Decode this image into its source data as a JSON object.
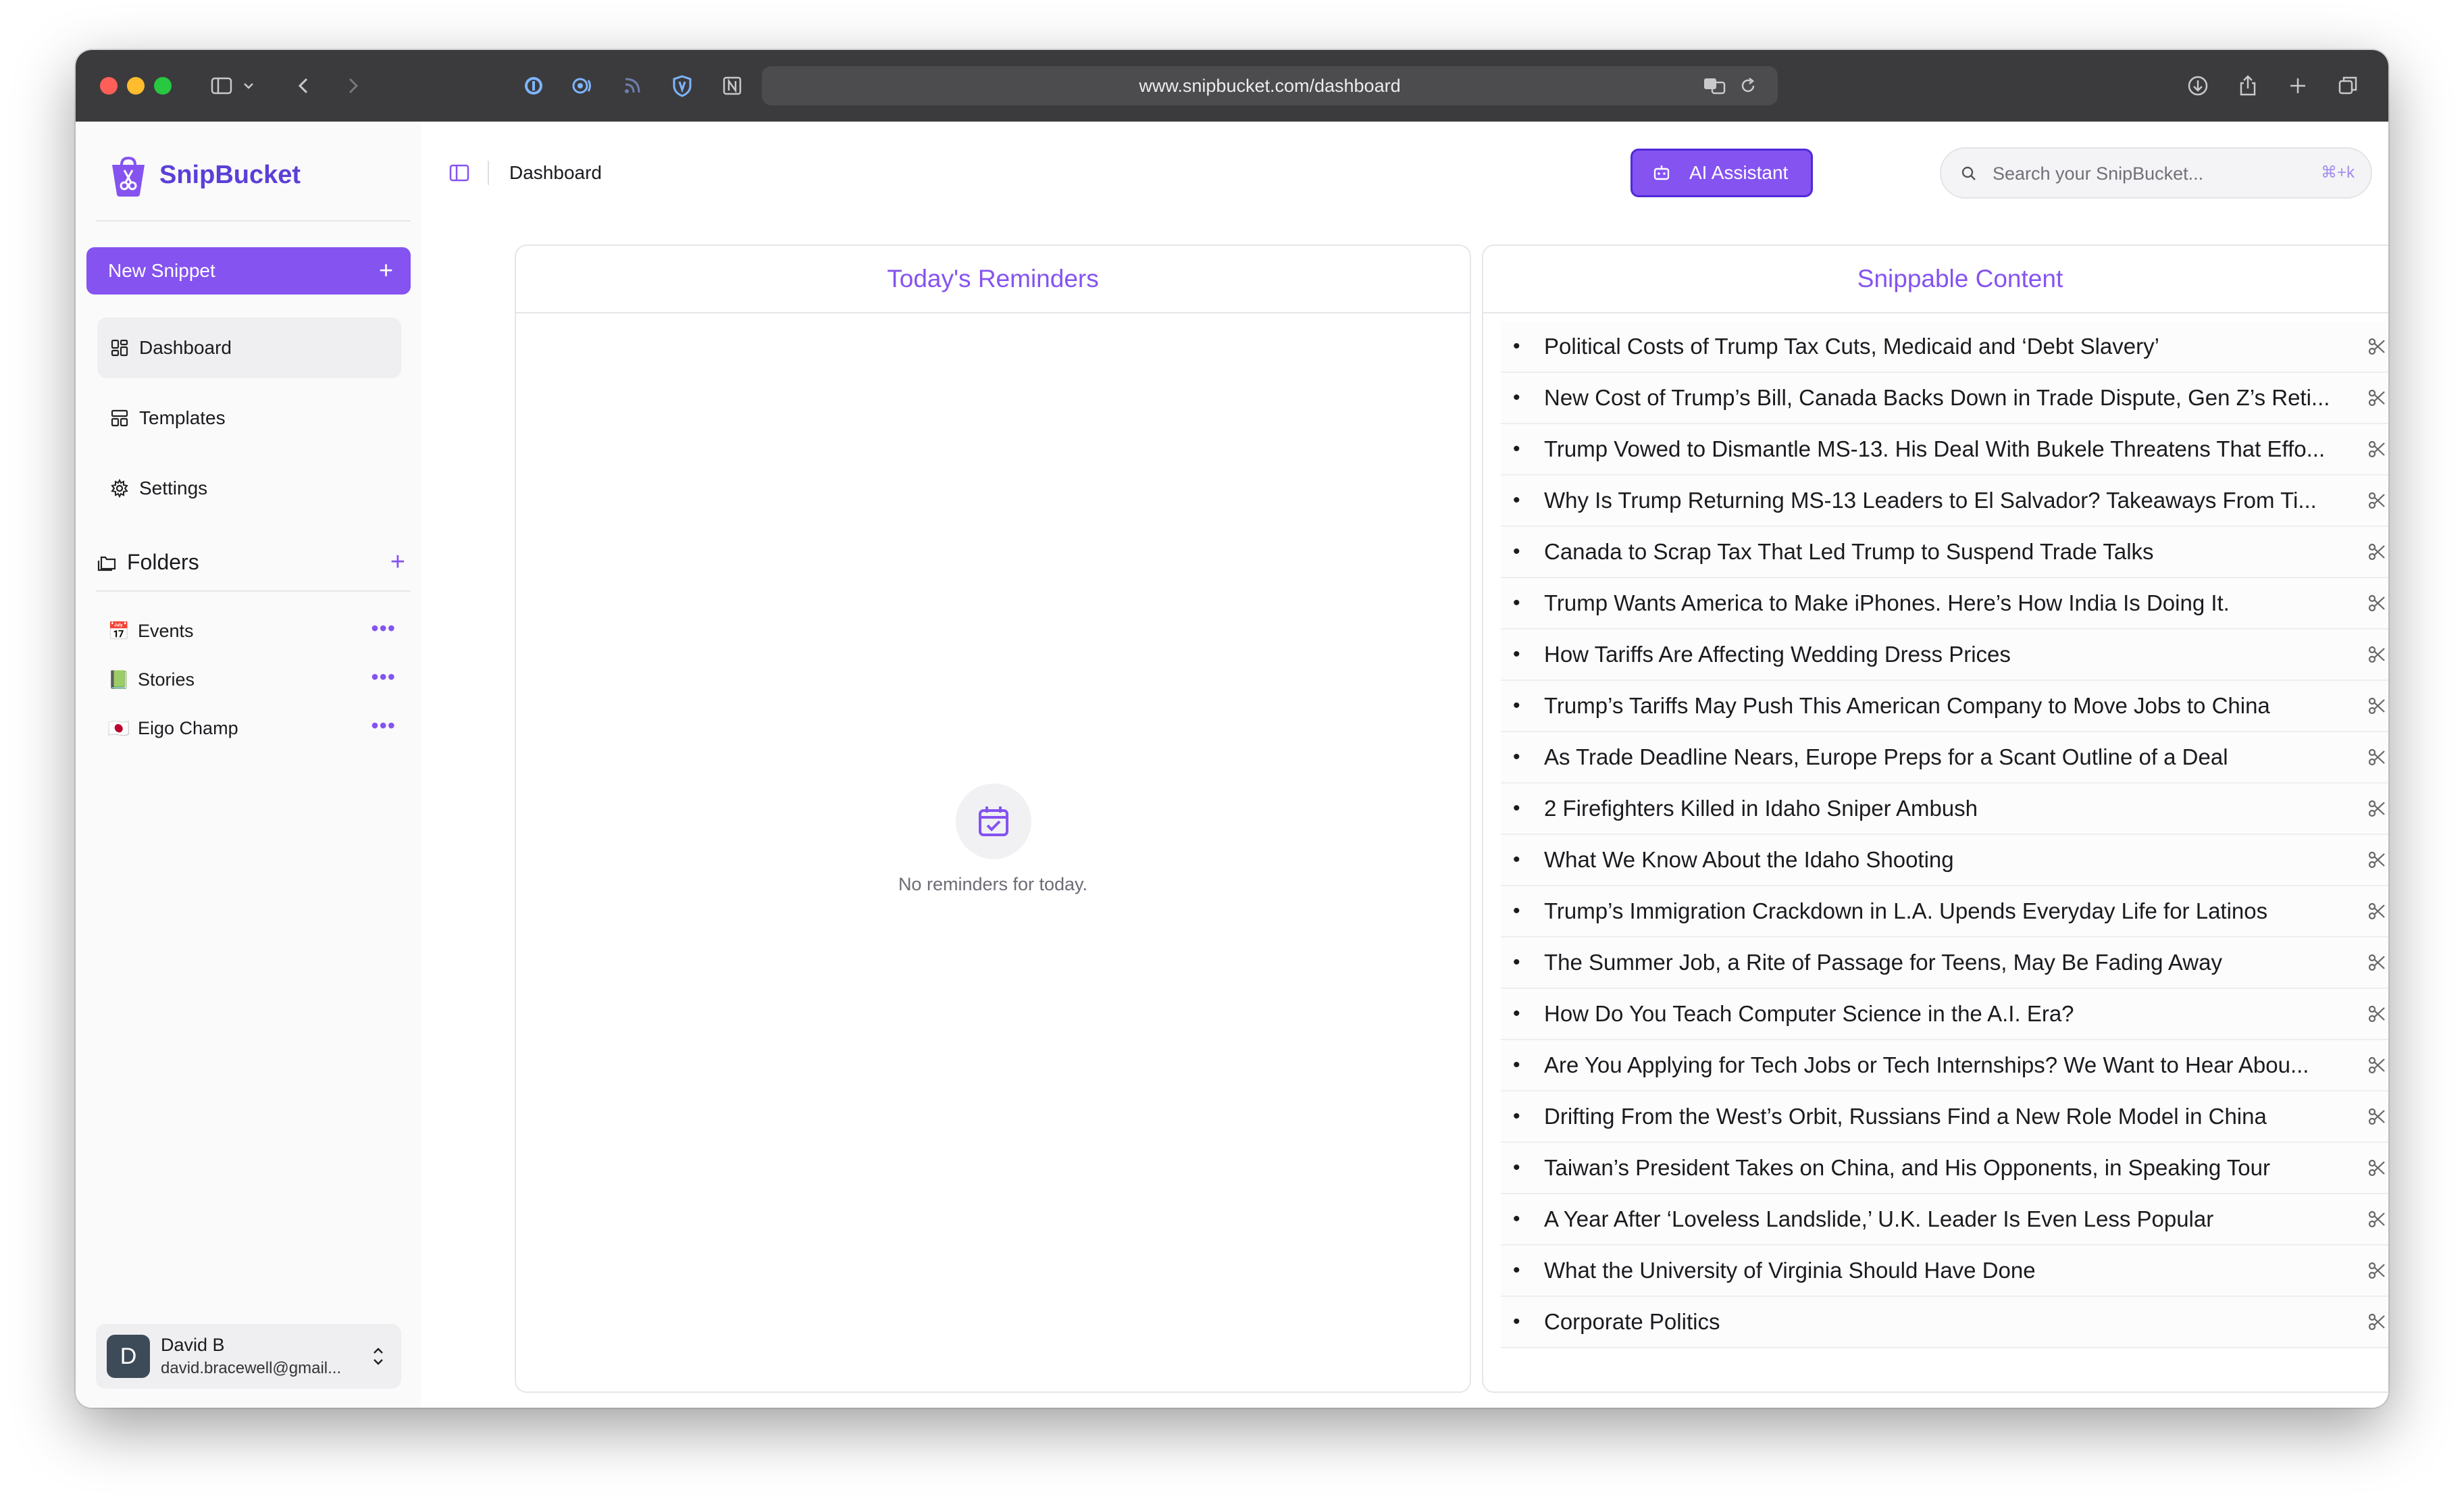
{
  "browser": {
    "url": "www.snipbucket.com/dashboard",
    "traffic_colors": [
      "#ff5f57",
      "#febc2e",
      "#28c840"
    ]
  },
  "sidebar": {
    "brand": "SnipBucket",
    "new_snippet_label": "New Snippet",
    "nav": [
      {
        "label": "Dashboard",
        "icon": "dashboard-icon"
      },
      {
        "label": "Templates",
        "icon": "templates-icon"
      },
      {
        "label": "Settings",
        "icon": "gear-icon"
      }
    ],
    "folders_label": "Folders",
    "folders": [
      {
        "emoji": "📅",
        "name": "Events"
      },
      {
        "emoji": "📗",
        "name": "Stories"
      },
      {
        "emoji": "🇯🇵",
        "name": "Eigo Champ"
      }
    ],
    "user": {
      "initial": "D",
      "name": "David B",
      "email": "david.bracewell@gmail..."
    }
  },
  "header": {
    "breadcrumb": "Dashboard",
    "ai_button": "AI Assistant",
    "search_placeholder": "Search your SnipBucket...",
    "search_shortcut": "⌘+k"
  },
  "reminders": {
    "title": "Today's Reminders",
    "empty_text": "No reminders for today."
  },
  "content": {
    "title": "Snippable Content",
    "items": [
      "Political Costs of Trump Tax Cuts, Medicaid and ‘Debt Slavery’",
      "New Cost of Trump’s Bill, Canada Backs Down in Trade Dispute, Gen Z’s Reti...",
      "Trump Vowed to Dismantle MS-13. His Deal With Bukele Threatens That Effo...",
      "Why Is Trump Returning MS-13 Leaders to El Salvador? Takeaways From Ti...",
      "Canada to Scrap Tax That Led Trump to Suspend Trade Talks",
      "Trump Wants America to Make iPhones. Here’s How India Is Doing It.",
      "How Tariffs Are Affecting Wedding Dress Prices",
      "Trump’s Tariffs May Push This American Company to Move Jobs to China",
      "As Trade Deadline Nears, Europe Preps for a Scant Outline of a Deal",
      "2 Firefighters Killed in Idaho Sniper Ambush",
      "What We Know About the Idaho Shooting",
      "Trump’s Immigration Crackdown in L.A. Upends Everyday Life for Latinos",
      "The Summer Job, a Rite of Passage for Teens, May Be Fading Away",
      "How Do You Teach Computer Science in the A.I. Era?",
      "Are You Applying for Tech Jobs or Tech Internships? We Want to Hear Abou...",
      "Drifting From the West’s Orbit, Russians Find a New Role Model in China",
      "Taiwan’s President Takes on China, and His Opponents, in Speaking Tour",
      "A Year After ‘Loveless Landslide,’ U.K. Leader Is Even Less Popular",
      "What the University of Virginia Should Have Done",
      "Corporate Politics"
    ]
  },
  "colors": {
    "accent": "#8553f0",
    "brand": "#5b3fd6"
  }
}
